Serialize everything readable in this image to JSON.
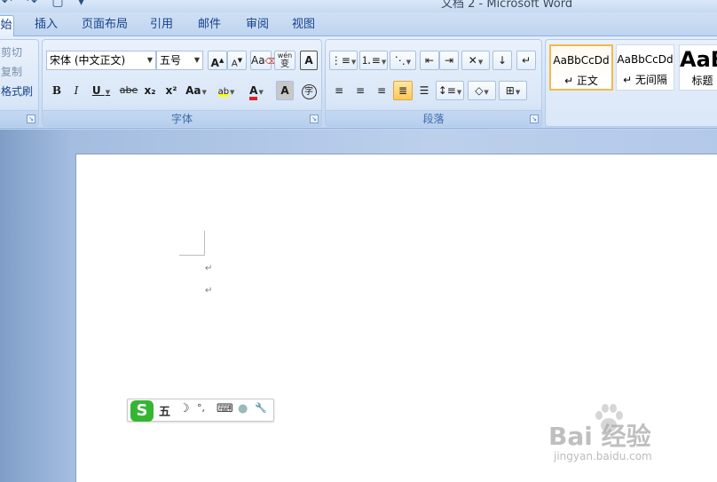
{
  "window": {
    "title": "文档 2 - Microsoft Word",
    "quick_access": "↶ ↷ ▢ ▾"
  },
  "tabs": [
    {
      "label": "始",
      "active": true
    },
    {
      "label": "插入"
    },
    {
      "label": "页面布局"
    },
    {
      "label": "引用"
    },
    {
      "label": "邮件"
    },
    {
      "label": "审阅"
    },
    {
      "label": "视图"
    }
  ],
  "clipboard": {
    "cut": "剪切",
    "copy": "复制",
    "format_painter": "格式刷"
  },
  "font_group": {
    "label": "字体",
    "font_name": "宋体 (中文正文)",
    "font_size": "五号",
    "grow": "A",
    "shrink": "A",
    "phonetic": "a",
    "char_border": "A",
    "bold": "B",
    "italic": "I",
    "underline": "U",
    "strike": "abe",
    "subscript": "x₂",
    "superscript": "x²",
    "change_case": "Aa",
    "highlight": "ab",
    "font_color": "A",
    "shading": "A",
    "enclose": "字",
    "wen": "wén",
    "wen_char": "变"
  },
  "paragraph_group": {
    "label": "段落"
  },
  "styles": [
    {
      "sample": "AaBbCcDd",
      "name": "↵ 正文",
      "selected": true
    },
    {
      "sample": "AaBbCcDd",
      "name": "↵ 无间隔"
    },
    {
      "sample": "AaB",
      "name": "标题"
    }
  ],
  "document": {
    "paragraph_marks": [
      "↵",
      "↵"
    ]
  },
  "ime": {
    "logo": "S",
    "mode": "五",
    "moon": "☽",
    "punct": "°,",
    "keyboard": "⌨",
    "skin": "●",
    "tools": "🔧"
  },
  "watermark": {
    "brand": "Bai 经验",
    "url": "jingyan.baidu.com"
  },
  "colors": {
    "accent": "#15428b",
    "highlight_yellow": "#ffff00",
    "font_red": "#e02020",
    "ime_green": "#35b534"
  }
}
